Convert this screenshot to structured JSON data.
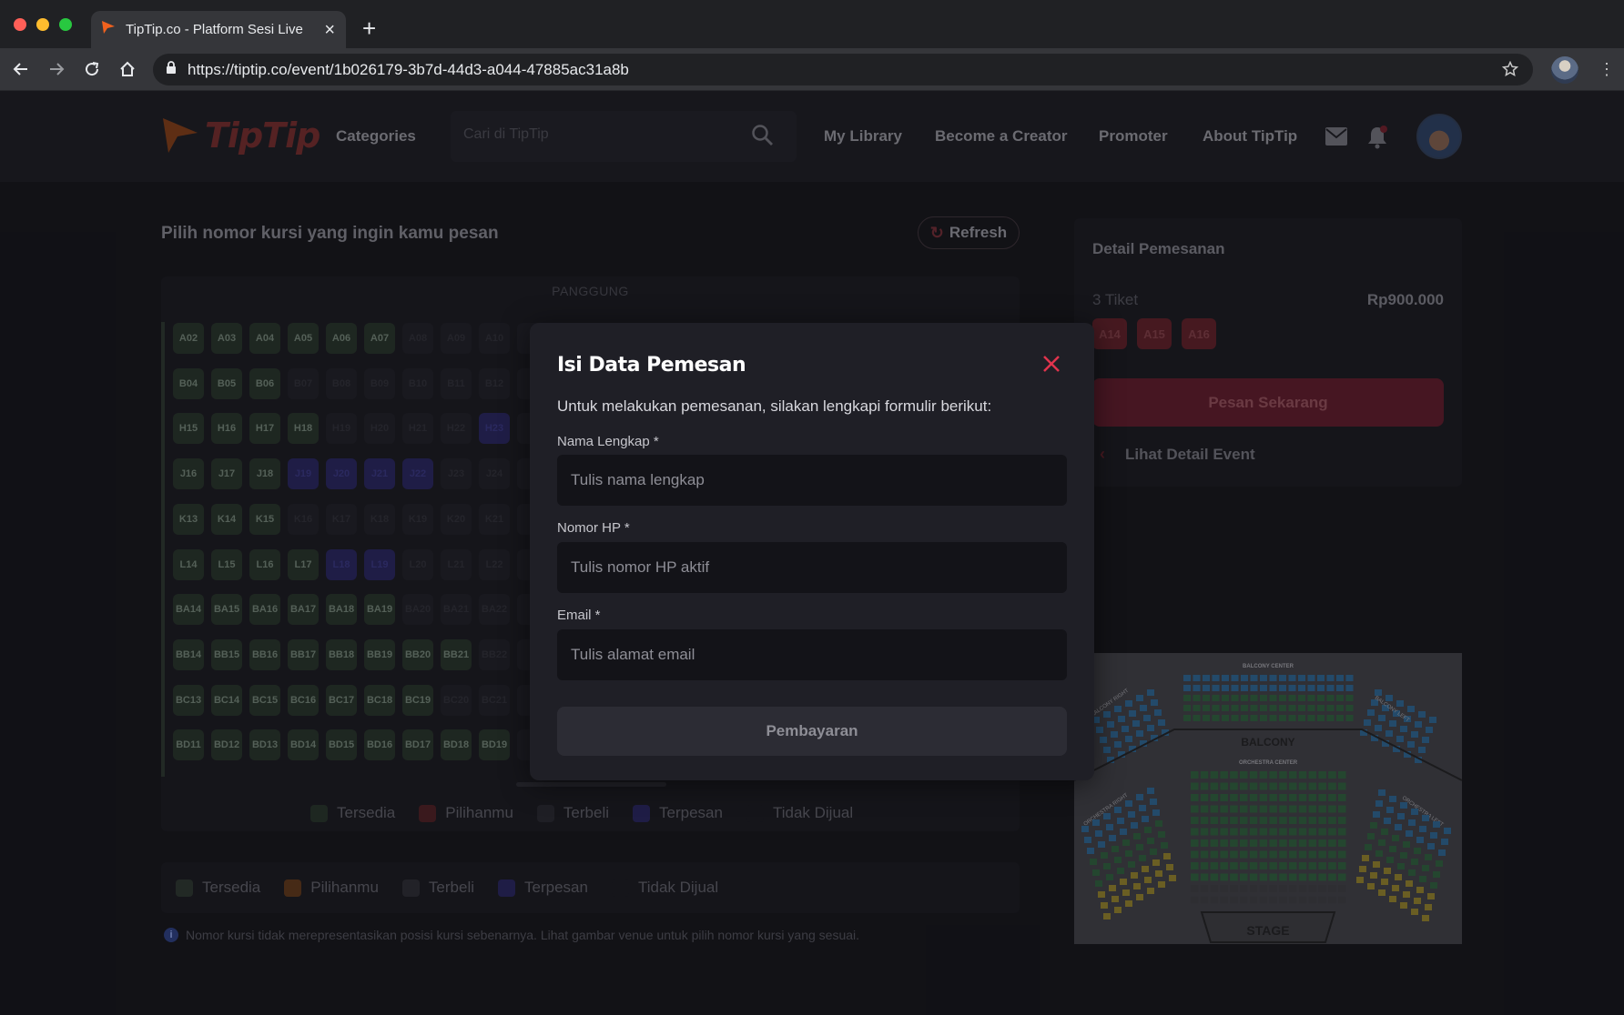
{
  "browser": {
    "tab_title": "TipTip.co - Platform Sesi Live",
    "url": "https://tiptip.co/event/1b026179-3b7d-44d3-a044-47885ac31a8b"
  },
  "header": {
    "logo_text": "TipTip",
    "categories": "Categories",
    "search_placeholder": "Cari di TipTip",
    "nav": [
      "My Library",
      "Become a Creator",
      "Promoter",
      "About TipTip"
    ]
  },
  "seat_selection": {
    "title": "Pilih nomor kursi yang ingin kamu pesan",
    "refresh": "Refresh",
    "stage": "PANGGUNG",
    "rows": [
      {
        "seats": [
          [
            "A02",
            "t"
          ],
          [
            "A03",
            "t"
          ],
          [
            "A04",
            "t"
          ],
          [
            "A05",
            "t"
          ],
          [
            "A06",
            "t"
          ],
          [
            "A07",
            "t"
          ],
          [
            "A08",
            "b"
          ],
          [
            "A09",
            "b"
          ],
          [
            "A10",
            "b"
          ]
        ]
      },
      {
        "seats": [
          [
            "B04",
            "t"
          ],
          [
            "B05",
            "t"
          ],
          [
            "B06",
            "t"
          ],
          [
            "B07",
            "b"
          ],
          [
            "B08",
            "b"
          ],
          [
            "B09",
            "b"
          ],
          [
            "B10",
            "b"
          ],
          [
            "B11",
            "b"
          ],
          [
            "B12",
            "b"
          ]
        ]
      },
      {
        "seats": [
          [
            "H15",
            "t"
          ],
          [
            "H16",
            "t"
          ],
          [
            "H17",
            "t"
          ],
          [
            "H18",
            "t"
          ],
          [
            "H19",
            "b"
          ],
          [
            "H20",
            "b"
          ],
          [
            "H21",
            "b"
          ],
          [
            "H22",
            "b"
          ],
          [
            "H23",
            "p"
          ]
        ]
      },
      {
        "seats": [
          [
            "J16",
            "t"
          ],
          [
            "J17",
            "t"
          ],
          [
            "J18",
            "t"
          ],
          [
            "J19",
            "p"
          ],
          [
            "J20",
            "p"
          ],
          [
            "J21",
            "p"
          ],
          [
            "J22",
            "p"
          ],
          [
            "J23",
            "b"
          ],
          [
            "J24",
            "b"
          ]
        ]
      },
      {
        "seats": [
          [
            "K13",
            "t"
          ],
          [
            "K14",
            "t"
          ],
          [
            "K15",
            "t"
          ],
          [
            "K16",
            "b"
          ],
          [
            "K17",
            "b"
          ],
          [
            "K18",
            "b"
          ],
          [
            "K19",
            "b"
          ],
          [
            "K20",
            "b"
          ],
          [
            "K21",
            "b"
          ]
        ]
      },
      {
        "seats": [
          [
            "L14",
            "t"
          ],
          [
            "L15",
            "t"
          ],
          [
            "L16",
            "t"
          ],
          [
            "L17",
            "t"
          ],
          [
            "L18",
            "p"
          ],
          [
            "L19",
            "p"
          ],
          [
            "L20",
            "b"
          ],
          [
            "L21",
            "b"
          ],
          [
            "L22",
            "b"
          ]
        ]
      },
      {
        "seats": [
          [
            "BA14",
            "t"
          ],
          [
            "BA15",
            "t"
          ],
          [
            "BA16",
            "t"
          ],
          [
            "BA17",
            "t"
          ],
          [
            "BA18",
            "t"
          ],
          [
            "BA19",
            "t"
          ],
          [
            "BA20",
            "b"
          ],
          [
            "BA21",
            "b"
          ],
          [
            "BA22",
            "b"
          ]
        ]
      },
      {
        "seats": [
          [
            "BB14",
            "t"
          ],
          [
            "BB15",
            "t"
          ],
          [
            "BB16",
            "t"
          ],
          [
            "BB17",
            "t"
          ],
          [
            "BB18",
            "t"
          ],
          [
            "BB19",
            "t"
          ],
          [
            "BB20",
            "t"
          ],
          [
            "BB21",
            "t"
          ],
          [
            "BB22",
            "b"
          ]
        ]
      },
      {
        "seats": [
          [
            "BC13",
            "t"
          ],
          [
            "BC14",
            "t"
          ],
          [
            "BC15",
            "t"
          ],
          [
            "BC16",
            "t"
          ],
          [
            "BC17",
            "t"
          ],
          [
            "BC18",
            "t"
          ],
          [
            "BC19",
            "t"
          ],
          [
            "BC20",
            "b"
          ],
          [
            "BC21",
            "b"
          ]
        ]
      },
      {
        "seats": [
          [
            "BD11",
            "t"
          ],
          [
            "BD12",
            "t"
          ],
          [
            "BD13",
            "t"
          ],
          [
            "BD14",
            "t"
          ],
          [
            "BD15",
            "t"
          ],
          [
            "BD16",
            "t"
          ],
          [
            "BD17",
            "t"
          ],
          [
            "BD18",
            "t"
          ],
          [
            "BD19",
            "t"
          ]
        ]
      }
    ],
    "legend": [
      {
        "label": "Tersedia",
        "color": "#253027"
      },
      {
        "label": "Pilihanmu",
        "color": "#4a1e22"
      },
      {
        "label": "Terbeli",
        "color": "#26262c"
      },
      {
        "label": "Terpesan",
        "color": "#262358"
      },
      {
        "label": "Tidak Dijual",
        "color": "#18181e"
      }
    ],
    "legend2": [
      {
        "label": "Tersedia",
        "color": "#2a332d"
      },
      {
        "label": "Pilihanmu",
        "color": "#5a3418"
      },
      {
        "label": "Terbeli",
        "color": "#2a2a30"
      },
      {
        "label": "Terpesan",
        "color": "#262358"
      },
      {
        "label": "Tidak Dijual",
        "color": "#18181e"
      }
    ],
    "note": "Nomor kursi tidak merepresentasikan posisi kursi sebenarnya. Lihat gambar venue untuk pilih nomor kursi yang sesuai."
  },
  "order": {
    "title": "Detail Pemesanan",
    "ticket_count": "3 Tiket",
    "price": "Rp900.000",
    "seats": [
      "A14",
      "A15",
      "A16"
    ],
    "order_button": "Pesan Sekarang",
    "event_link": "Lihat Detail Event"
  },
  "venue_map": {
    "balcony_center": "BALCONY CENTER",
    "balcony": "BALCONY",
    "orchestra_center": "ORCHESTRA CENTER",
    "stage": "STAGE",
    "balcony_left": "BALCONY LEFT",
    "balcony_right": "BALCONY RIGHT",
    "orchestra_left": "ORCHESTRA LEFT",
    "orchestra_right": "ORCHESTRA RIGHT"
  },
  "modal": {
    "title": "Isi Data Pemesan",
    "description": "Untuk melakukan pemesanan, silakan lengkapi formulir berikut:",
    "name_label": "Nama Lengkap *",
    "name_placeholder": "Tulis nama lengkap",
    "phone_label": "Nomor HP *",
    "phone_placeholder": "Tulis nomor HP aktif",
    "email_label": "Email *",
    "email_placeholder": "Tulis alamat email",
    "submit": "Pembayaran"
  },
  "colors": {
    "accent": "#e0344d",
    "brand": "#f0611e"
  }
}
